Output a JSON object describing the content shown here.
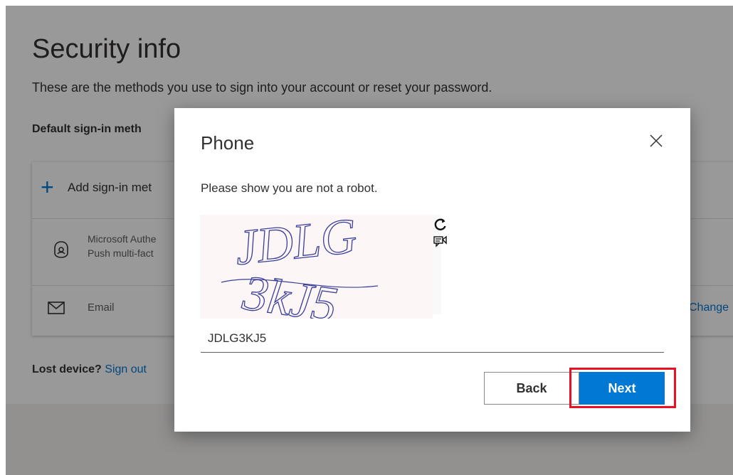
{
  "page": {
    "title": "Security info",
    "subtitle": "These are the methods you use to sign into your account or reset your password.",
    "default_label": "Default sign-in meth",
    "methods": {
      "add_label": "Add sign-in met",
      "authenticator": {
        "line1": "Microsoft Authe",
        "line2": "Push multi-fact",
        "icon": "authenticator-lock-icon"
      },
      "email": {
        "label": "Email",
        "icon": "mail-envelope-icon",
        "change_link": "Change"
      }
    },
    "lost_device": {
      "label": "Lost device?",
      "link": "Sign out"
    }
  },
  "dialog": {
    "title": "Phone",
    "prompt": "Please show you are not a robot.",
    "captcha": {
      "line1": "JDLG",
      "line2": "3kJ5",
      "refresh_icon": "refresh-icon",
      "audio_icon": "audio-speaker-icon"
    },
    "input_value": "JDLG3KJ5",
    "back_label": "Back",
    "next_label": "Next",
    "close_icon": "close-icon"
  },
  "colors": {
    "accent": "#0078d4",
    "highlight": "#e81123",
    "overlay": "rgba(0,0,0,0.4)"
  }
}
